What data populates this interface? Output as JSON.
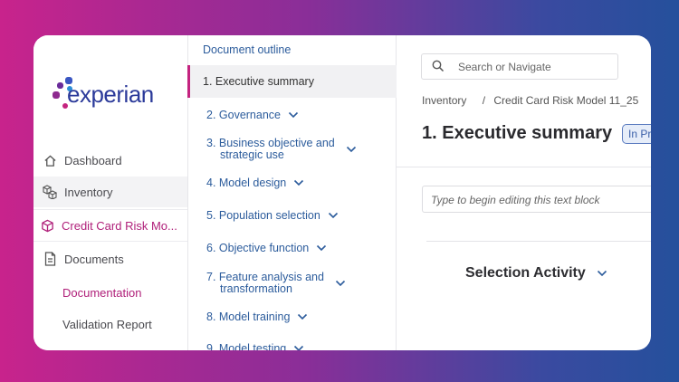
{
  "brand": {
    "logo_text": "experian",
    "colors": {
      "primary": "#2b3a9a",
      "accent": "#c4237f"
    }
  },
  "sidebar": {
    "items": [
      {
        "label": "Dashboard",
        "icon": "home-icon"
      },
      {
        "label": "Inventory",
        "icon": "cubes-icon"
      },
      {
        "label": "Credit Card Risk Mo...",
        "icon": "cube-icon"
      },
      {
        "label": "Documents",
        "icon": "document-icon"
      }
    ],
    "sub_items": [
      {
        "label": "Documentation"
      },
      {
        "label": "Validation Report"
      }
    ]
  },
  "outline": {
    "title": "Document outline",
    "selected": "1. Executive summary",
    "items": [
      {
        "label": "2. Governance"
      },
      {
        "label": "3. Business objective and",
        "label2": "strategic use"
      },
      {
        "label": "4. Model design"
      },
      {
        "label": "5. Population selection"
      },
      {
        "label": "6. Objective function"
      },
      {
        "label": "7. Feature analysis and",
        "label2": "transformation"
      },
      {
        "label": "8. Model training"
      },
      {
        "label": "9. Model testing"
      }
    ]
  },
  "main": {
    "search_placeholder": "Search or Navigate",
    "breadcrumb": {
      "first": "Inventory",
      "sep": "/",
      "second": "Credit Card Risk Model 11_25"
    },
    "title": "1. Executive summary",
    "status_badge": "In Pr",
    "editor_placeholder": "Type to begin editing this text block",
    "section_title": "Selection Activity"
  }
}
